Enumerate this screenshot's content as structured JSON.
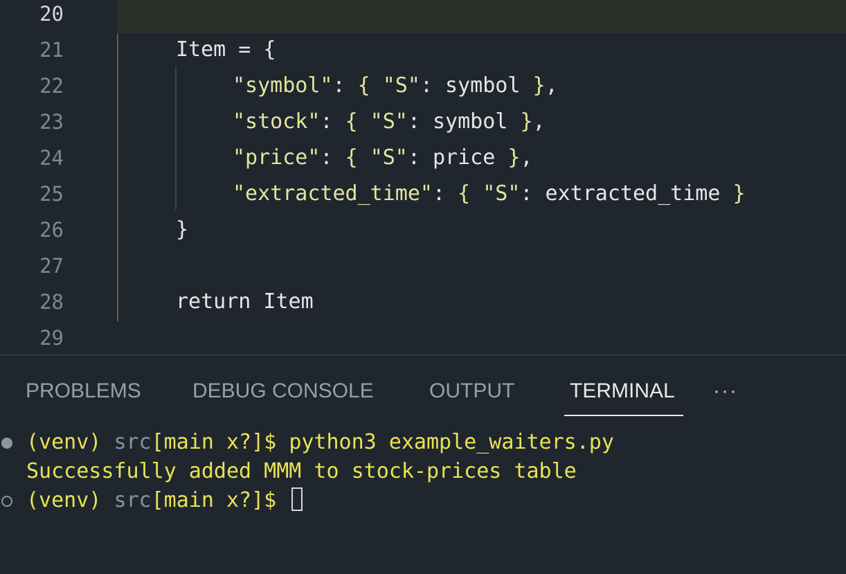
{
  "editor": {
    "lines": [
      {
        "num": "20"
      },
      {
        "num": "21",
        "tokens": [
          "Item = {"
        ]
      },
      {
        "num": "22",
        "tokens": [
          "\"symbol\"",
          ": ",
          "{",
          " ",
          "\"S\"",
          ": symbol ",
          "}",
          ","
        ]
      },
      {
        "num": "23",
        "tokens": [
          "\"stock\"",
          ": ",
          "{",
          " ",
          "\"S\"",
          ": symbol ",
          "}",
          ","
        ]
      },
      {
        "num": "24",
        "tokens": [
          "\"price\"",
          ": ",
          "{",
          " ",
          "\"S\"",
          ": price ",
          "}",
          ","
        ]
      },
      {
        "num": "25",
        "tokens": [
          "\"extracted_time\"",
          ": ",
          "{",
          " ",
          "\"S\"",
          ": extracted_time ",
          "}"
        ]
      },
      {
        "num": "26",
        "tokens": [
          "}"
        ]
      },
      {
        "num": "27"
      },
      {
        "num": "28",
        "tokens": [
          "return Item"
        ]
      },
      {
        "num": "29"
      }
    ]
  },
  "panel": {
    "tabs": [
      {
        "label": "PROBLEMS"
      },
      {
        "label": "DEBUG CONSOLE"
      },
      {
        "label": "OUTPUT"
      },
      {
        "label": "TERMINAL"
      }
    ],
    "more_label": "···"
  },
  "terminal": {
    "lines": [
      {
        "env": "(venv) ",
        "dir": "src",
        "branch": "[main x?]$ ",
        "cmd": "python3 example_waiters.py"
      },
      {
        "output": "Successfully added MMM to stock-prices table"
      },
      {
        "env": "(venv) ",
        "dir": "src",
        "branch": "[main x?]$ ",
        "cmd": ""
      }
    ]
  },
  "colors": {
    "background": "#1f262d",
    "string": "#e4e49c",
    "terminal_yellow": "#e9e255",
    "line_number": "#7e8891"
  }
}
